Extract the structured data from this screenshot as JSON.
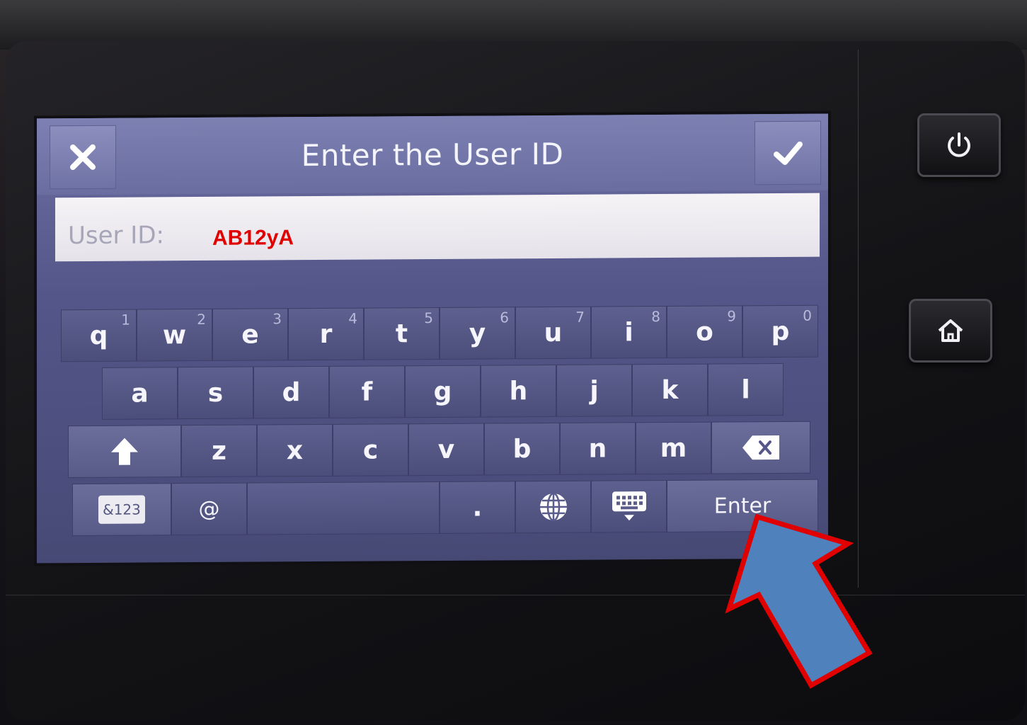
{
  "dialog": {
    "title": "Enter the User ID",
    "close_icon": "close-icon",
    "confirm_icon": "checkmark-icon"
  },
  "field": {
    "label": "User ID:",
    "value": "AB12yA"
  },
  "keyboard": {
    "row1": [
      {
        "key": "q",
        "sup": "1"
      },
      {
        "key": "w",
        "sup": "2"
      },
      {
        "key": "e",
        "sup": "3"
      },
      {
        "key": "r",
        "sup": "4"
      },
      {
        "key": "t",
        "sup": "5"
      },
      {
        "key": "y",
        "sup": "6"
      },
      {
        "key": "u",
        "sup": "7"
      },
      {
        "key": "i",
        "sup": "8"
      },
      {
        "key": "o",
        "sup": "9"
      },
      {
        "key": "p",
        "sup": "0"
      }
    ],
    "row2": [
      "a",
      "s",
      "d",
      "f",
      "g",
      "h",
      "j",
      "k",
      "l"
    ],
    "row3": [
      "z",
      "x",
      "c",
      "v",
      "b",
      "n",
      "m"
    ],
    "symbols_label": "&123",
    "at_label": "@",
    "period_label": ".",
    "enter_label": "Enter",
    "icons": {
      "shift": "shift-arrow-icon",
      "backspace": "backspace-icon",
      "language": "globe-icon",
      "hide_keyboard": "keyboard-hide-icon"
    }
  },
  "hardware": {
    "power_icon": "power-icon",
    "home_icon": "home-icon"
  },
  "annotation": {
    "arrow_fill": "#4f81bd",
    "arrow_stroke": "#e00000",
    "value_color": "#e00000"
  }
}
